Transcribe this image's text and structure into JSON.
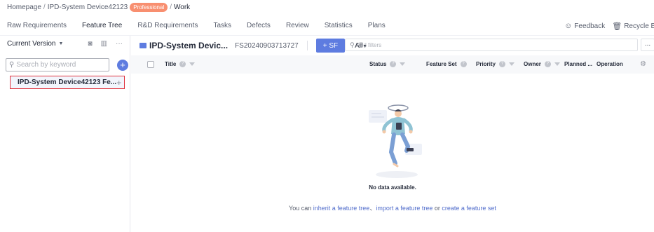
{
  "breadcrumb": {
    "home": "Homepage",
    "project": "IPD-System Device42123",
    "badge": "Professional",
    "current": "Work"
  },
  "tabs": [
    "Raw Requirements",
    "Feature Tree",
    "R&D Requirements",
    "Tasks",
    "Defects",
    "Review",
    "Statistics",
    "Plans"
  ],
  "active_tab": "Feature Tree",
  "header_actions": {
    "feedback": "Feedback",
    "recycle": "Recycle Bin"
  },
  "left_panel": {
    "version_label": "Current Version",
    "search_placeholder": "Search by keyword",
    "tree_item": "IPD-System Device42123 Fe..."
  },
  "toolbar": {
    "title": "IPD-System Devic...",
    "code": "FS20240903713727",
    "add_sf": "+ SF",
    "scope": "All",
    "filter_placeholder": "Add filters",
    "more": "..."
  },
  "columns": {
    "title": "Title",
    "status": "Status",
    "feature_set": "Feature Set",
    "priority": "Priority",
    "owner": "Owner",
    "planned": "Planned ...",
    "operation": "Operation"
  },
  "empty": {
    "title": "No data available.",
    "prefix": "You can ",
    "link1": "inherit a feature tree",
    "sep": "、",
    "link2": "import a feature tree",
    "or": " or ",
    "link3": "create a feature set"
  },
  "colors": {
    "accent": "#5e7ce0",
    "badge": "#f88f70",
    "highlight_border": "#e0333f",
    "folder_yellow": "#f6c14f"
  }
}
